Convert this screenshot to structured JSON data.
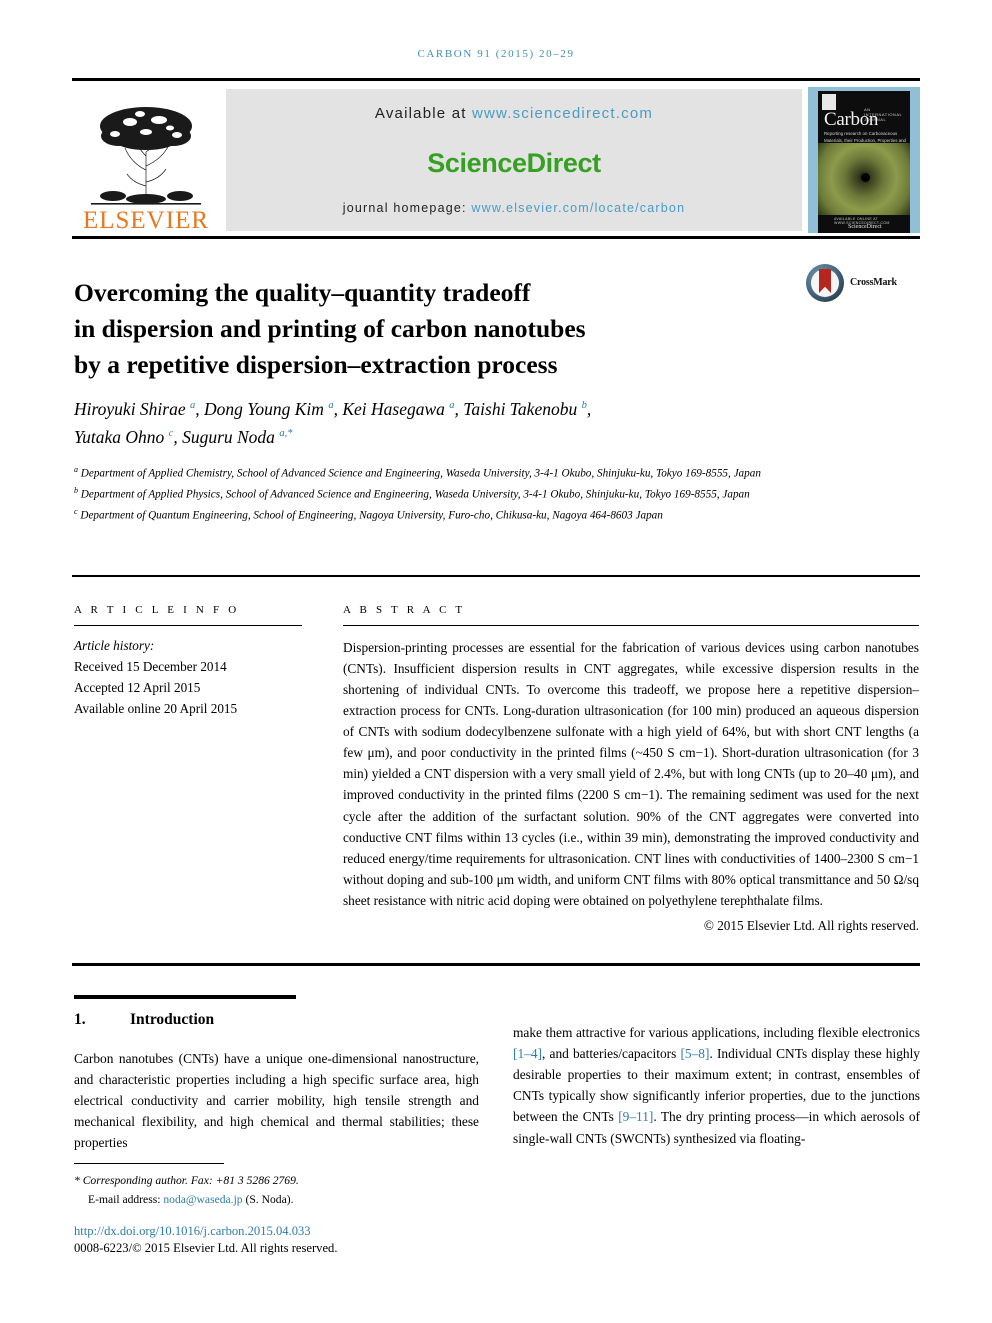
{
  "running_head": "CARBON 91 (2015) 20–29",
  "masthead": {
    "publisher_name": "ELSEVIER",
    "available_prefix": "Available at ",
    "available_url": "www.sciencedirect.com",
    "sciencedirect_logo": "ScienceDirect",
    "homepage_prefix": "journal homepage: ",
    "homepage_url": "www.elsevier.com/locate/carbon",
    "cover": {
      "journal_title": "Carbon",
      "superline": "AN INTERNATIONAL JOURNAL",
      "subline": "Reporting research on Carbonaceous Materials, their Production, Properties and Applications",
      "footer_small": "AVAILABLE ONLINE AT WWW.SCIENCEDIRECT.COM",
      "footer_brand": "ScienceDirect"
    }
  },
  "article": {
    "title_lines": [
      "Overcoming the quality–quantity tradeoff",
      "in dispersion and printing of carbon nanotubes",
      "by a repetitive dispersion–extraction process"
    ],
    "crossmark_label": "CrossMark",
    "authors_html": "Hiroyuki Shirae <sup>a</sup>, Dong Young Kim <sup>a</sup>, Kei Hasegawa <sup>a</sup>, Taishi Takenobu <sup>b</sup>,<br>Yutaka Ohno <sup>c</sup>, Suguru Noda <sup>a,*</sup>",
    "affiliations": [
      "a Department of Applied Chemistry, School of Advanced Science and Engineering, Waseda University, 3-4-1 Okubo, Shinjuku-ku, Tokyo 169-8555, Japan",
      "b Department of Applied Physics, School of Advanced Science and Engineering, Waseda University, 3-4-1 Okubo, Shinjuku-ku, Tokyo 169-8555, Japan",
      "c Department of Quantum Engineering, School of Engineering, Nagoya University, Furo-cho, Chikusa-ku, Nagoya 464-8603 Japan"
    ]
  },
  "article_info": {
    "heading": "A R T I C L E  I N F O",
    "history_label": "Article history:",
    "received": "Received 15 December 2014",
    "accepted": "Accepted 12 April 2015",
    "available_online": "Available online 20 April 2015"
  },
  "abstract": {
    "heading": "A B S T R A C T",
    "text": "Dispersion-printing processes are essential for the fabrication of various devices using carbon nanotubes (CNTs). Insufficient dispersion results in CNT aggregates, while excessive dispersion results in the shortening of individual CNTs. To overcome this tradeoff, we propose here a repetitive dispersion–extraction process for CNTs. Long-duration ultrasonication (for 100 min) produced an aqueous dispersion of CNTs with sodium dodecylbenzene sulfonate with a high yield of 64%, but with short CNT lengths (a few μm), and poor conductivity in the printed films (~450 S cm−1). Short-duration ultrasonication (for 3 min) yielded a CNT dispersion with a very small yield of 2.4%, but with long CNTs (up to 20–40 μm), and improved conductivity in the printed films (2200 S cm−1). The remaining sediment was used for the next cycle after the addition of the surfactant solution. 90% of the CNT aggregates were converted into conductive CNT films within 13 cycles (i.e., within 39 min), demonstrating the improved conductivity and reduced energy/time requirements for ultrasonication. CNT lines with conductivities of 1400–2300 S cm−1 without doping and sub-100 μm width, and uniform CNT films with 80% optical transmittance and 50 Ω/sq sheet resistance with nitric acid doping were obtained on polyethylene terephthalate films.",
    "copyright": "© 2015 Elsevier Ltd. All rights reserved."
  },
  "introduction": {
    "number": "1.",
    "title": "Introduction",
    "left_paragraph": "Carbon nanotubes (CNTs) have a unique one-dimensional nanostructure, and characteristic properties including a high specific surface area, high electrical conductivity and carrier mobility, high tensile strength and mechanical flexibility, and high chemical and thermal stabilities; these properties",
    "right_paragraph_html": "make them attractive for various applications, including flexible electronics <span class=\"ref\">[1–4]</span>, and batteries/capacitors <span class=\"ref\">[5–8]</span>. Individual CNTs display these highly desirable properties to their maximum extent; in contrast, ensembles of CNTs typically show significantly inferior properties, due to the junctions between the CNTs <span class=\"ref\">[9–11]</span>. The dry printing process—in which aerosols of single-wall CNTs (SWCNTs) synthesized via floating-"
  },
  "footer": {
    "corresponding": "Corresponding author. Fax: +81 3 5286 2769.",
    "email_label": "E-mail address: ",
    "email": "noda@waseda.jp",
    "email_suffix": " (S. Noda).",
    "doi": "http://dx.doi.org/10.1016/j.carbon.2015.04.033",
    "issn_line": "0008-6223/© 2015 Elsevier Ltd. All rights reserved."
  },
  "colors": {
    "link_blue": "#2f7ca8",
    "header_blue": "#3f8fad",
    "elsevier_orange": "#E87722",
    "sciencedirect_green": "#35a022",
    "cover_blue": "#8fc0d8"
  }
}
